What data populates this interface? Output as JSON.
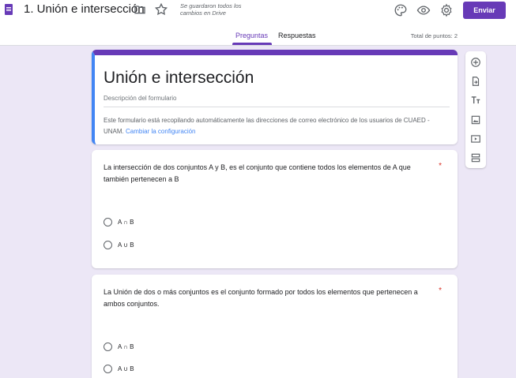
{
  "header": {
    "title": "1. Unión e intersección",
    "saved_status": "Se guardaron todos los cambios en Drive",
    "send_label": "Enviar",
    "icons": [
      "folder-icon",
      "star-icon",
      "palette-icon",
      "eye-icon",
      "gear-icon"
    ]
  },
  "tabs": [
    {
      "label": "Preguntas",
      "active": true
    },
    {
      "label": "Respuestas",
      "active": false
    }
  ],
  "total_points": "Total de puntos: 2",
  "form": {
    "title": "Unión e intersección",
    "description": "Descripción del formulario",
    "notice": "Este formulario está recopilando automáticamente las direcciones de correo electrónico de los usuarios de CUAED - UNAM.",
    "notice_link": "Cambiar la configuración"
  },
  "questions": [
    {
      "text": "La intersección de dos conjuntos A y B, es el conjunto que contiene todos los elementos de A que también pertenecen a B",
      "required_mark": "*",
      "options": [
        "A ∩ B",
        "A ∪ B"
      ]
    },
    {
      "text": "La Unión de dos o más conjuntos es el conjunto formado por todos los elementos que pertenecen a ambos conjuntos.",
      "required_mark": "*",
      "options": [
        "A ∩ B",
        "A ∪ B"
      ]
    }
  ],
  "side_toolbar": [
    "add-question-icon",
    "import-questions-icon",
    "add-title-icon",
    "add-image-icon",
    "add-video-icon",
    "add-section-icon"
  ],
  "colors": {
    "accent": "#673ab7",
    "background": "#ece7f6",
    "link": "#4285f4",
    "required": "#d93025"
  }
}
